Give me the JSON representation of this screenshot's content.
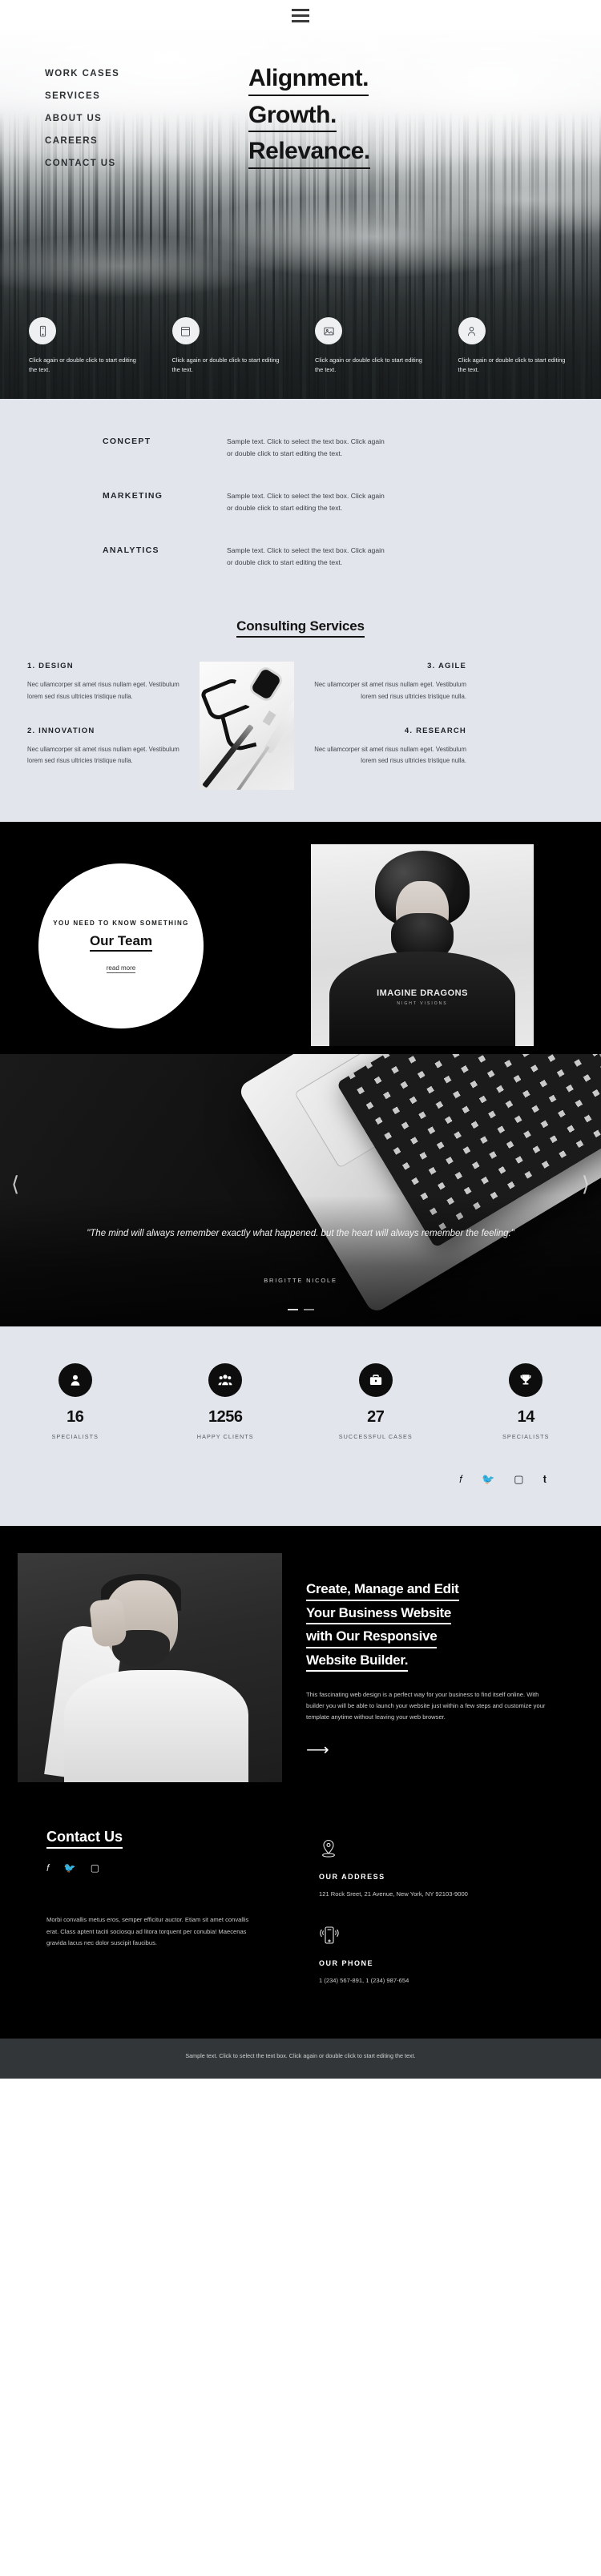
{
  "topbar": {
    "menu_icon": "hamburger-icon"
  },
  "hero": {
    "nav": [
      {
        "label": "WORK CASES"
      },
      {
        "label": "SERVICES"
      },
      {
        "label": "ABOUT US"
      },
      {
        "label": "CAREERS"
      },
      {
        "label": "CONTACT US"
      }
    ],
    "title_lines": [
      "Alignment.",
      "Growth.",
      "Relevance."
    ],
    "cards": [
      {
        "icon": "mobile-phone-icon",
        "text": "Click again or double click to start editing the text."
      },
      {
        "icon": "calendar-icon",
        "text": "Click again or double click to start editing the text."
      },
      {
        "icon": "image-icon",
        "text": "Click again or double click to start editing the text."
      },
      {
        "icon": "person-icon",
        "text": "Click again or double click to start editing the text."
      }
    ]
  },
  "services_list": [
    {
      "term": "CONCEPT",
      "desc": "Sample text. Click to select the text box. Click again or double click to start editing the text."
    },
    {
      "term": "MARKETING",
      "desc": "Sample text. Click to select the text box. Click again or double click to start editing the text."
    },
    {
      "term": "ANALYTICS",
      "desc": "Sample text. Click to select the text box. Click again or double click to start editing the text."
    }
  ],
  "consulting": {
    "title": "Consulting Services",
    "left": [
      {
        "heading": "1. DESIGN",
        "text": "Nec ullamcorper sit amet risus nullam eget. Vestibulum lorem sed risus ultricies tristique nulla."
      },
      {
        "heading": "2. INNOVATION",
        "text": "Nec ullamcorper sit amet risus nullam eget. Vestibulum lorem sed risus ultricies tristique nulla."
      }
    ],
    "right": [
      {
        "heading": "3. AGILE",
        "text": "Nec ullamcorper sit amet risus nullam eget. Vestibulum lorem sed risus ultricies tristique nulla."
      },
      {
        "heading": "4. RESEARCH",
        "text": "Nec ullamcorper sit amet risus nullam eget. Vestibulum lorem sed risus ultricies tristique nulla."
      }
    ]
  },
  "team": {
    "kicker": "YOU NEED TO KNOW SOMETHING",
    "title": "Our Team",
    "read_more": "read more",
    "photo_shirt_text": "IMAGINE DRAGONS",
    "photo_shirt_sub": "NIGHT VISIONS"
  },
  "quote": {
    "text": "\"The mind will always remember exactly what happened. but the heart will always remember the feeling.\"",
    "author": "BRIGITTE NICOLE",
    "prev_icon": "chevron-left-icon",
    "next_icon": "chevron-right-icon",
    "dots": 2,
    "active_dot": 1
  },
  "stats": [
    {
      "icon": "person-icon",
      "number": "16",
      "label": "SPECIALISTS"
    },
    {
      "icon": "people-group-icon",
      "number": "1256",
      "label": "HAPPY CLIENTS"
    },
    {
      "icon": "briefcase-icon",
      "number": "27",
      "label": "SUCCESSFUL CASES"
    },
    {
      "icon": "trophy-icon",
      "number": "14",
      "label": "SPECIALISTS"
    }
  ],
  "social_top": [
    {
      "name": "facebook-icon",
      "glyph": "f"
    },
    {
      "name": "twitter-icon",
      "glyph": "ᵛ"
    },
    {
      "name": "instagram-icon",
      "glyph": "□"
    },
    {
      "name": "tumblr-icon",
      "glyph": "t"
    }
  ],
  "cta": {
    "heading_lines": [
      "Create, Manage and Edit",
      "Your Business Website",
      "with Our Responsive",
      "Website Builder."
    ],
    "paragraph": "This fascinating web design is a perfect way for your business to find itself online. With builder you will be able to launch your website just within a few steps and customize your template anytime without leaving your web browser.",
    "arrow_icon": "arrow-right-icon"
  },
  "contact": {
    "title": "Contact Us",
    "social": [
      {
        "name": "facebook-icon",
        "glyph": "f"
      },
      {
        "name": "twitter-icon",
        "glyph": "ᵛ"
      },
      {
        "name": "instagram-icon",
        "glyph": "□"
      }
    ],
    "lorem": "Morbi convallis metus eros, semper efficitur auctor. Etiam sit amet convallis erat. Class aptent taciti sociosqu ad litora torquent per conubia! Maecenas gravida lacus nec dolor suscipit faucibus.",
    "address": {
      "icon": "map-pin-icon",
      "heading": "OUR ADDRESS",
      "value": "121 Rock Sreet, 21 Avenue, New York, NY 92103-9000"
    },
    "phone": {
      "icon": "mobile-phone-icon",
      "heading": "OUR PHONE",
      "value": "1 (234) 567-891, 1 (234) 987-654"
    }
  },
  "bottombar": {
    "text": "Sample text. Click to select the text box. Click again or double click to start editing the text."
  }
}
